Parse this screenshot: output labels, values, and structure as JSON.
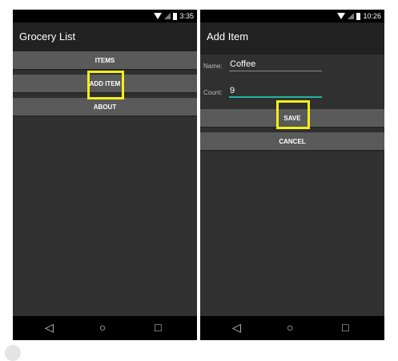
{
  "left_screen": {
    "status": {
      "time": "3:35"
    },
    "app_title": "Grocery List",
    "buttons": [
      "ITEMS",
      "ADD ITEM",
      "ABOUT"
    ]
  },
  "right_screen": {
    "status": {
      "time": "10:26"
    },
    "app_title": "Add Item",
    "form": {
      "name_label": "Name:",
      "name_value": "Coffee",
      "count_label": "Count:",
      "count_value": "9"
    },
    "buttons": {
      "save": "SAVE",
      "cancel": "CANCEL"
    }
  },
  "nav": {
    "back": "◁",
    "home": "○",
    "recents": "□"
  },
  "colors": {
    "highlight": "#f2ef1a",
    "focus_underline": "#22b3a0"
  },
  "icons": [
    "wifi-icon",
    "signal-icon",
    "battery-icon",
    "back-icon",
    "home-icon",
    "recents-icon"
  ]
}
